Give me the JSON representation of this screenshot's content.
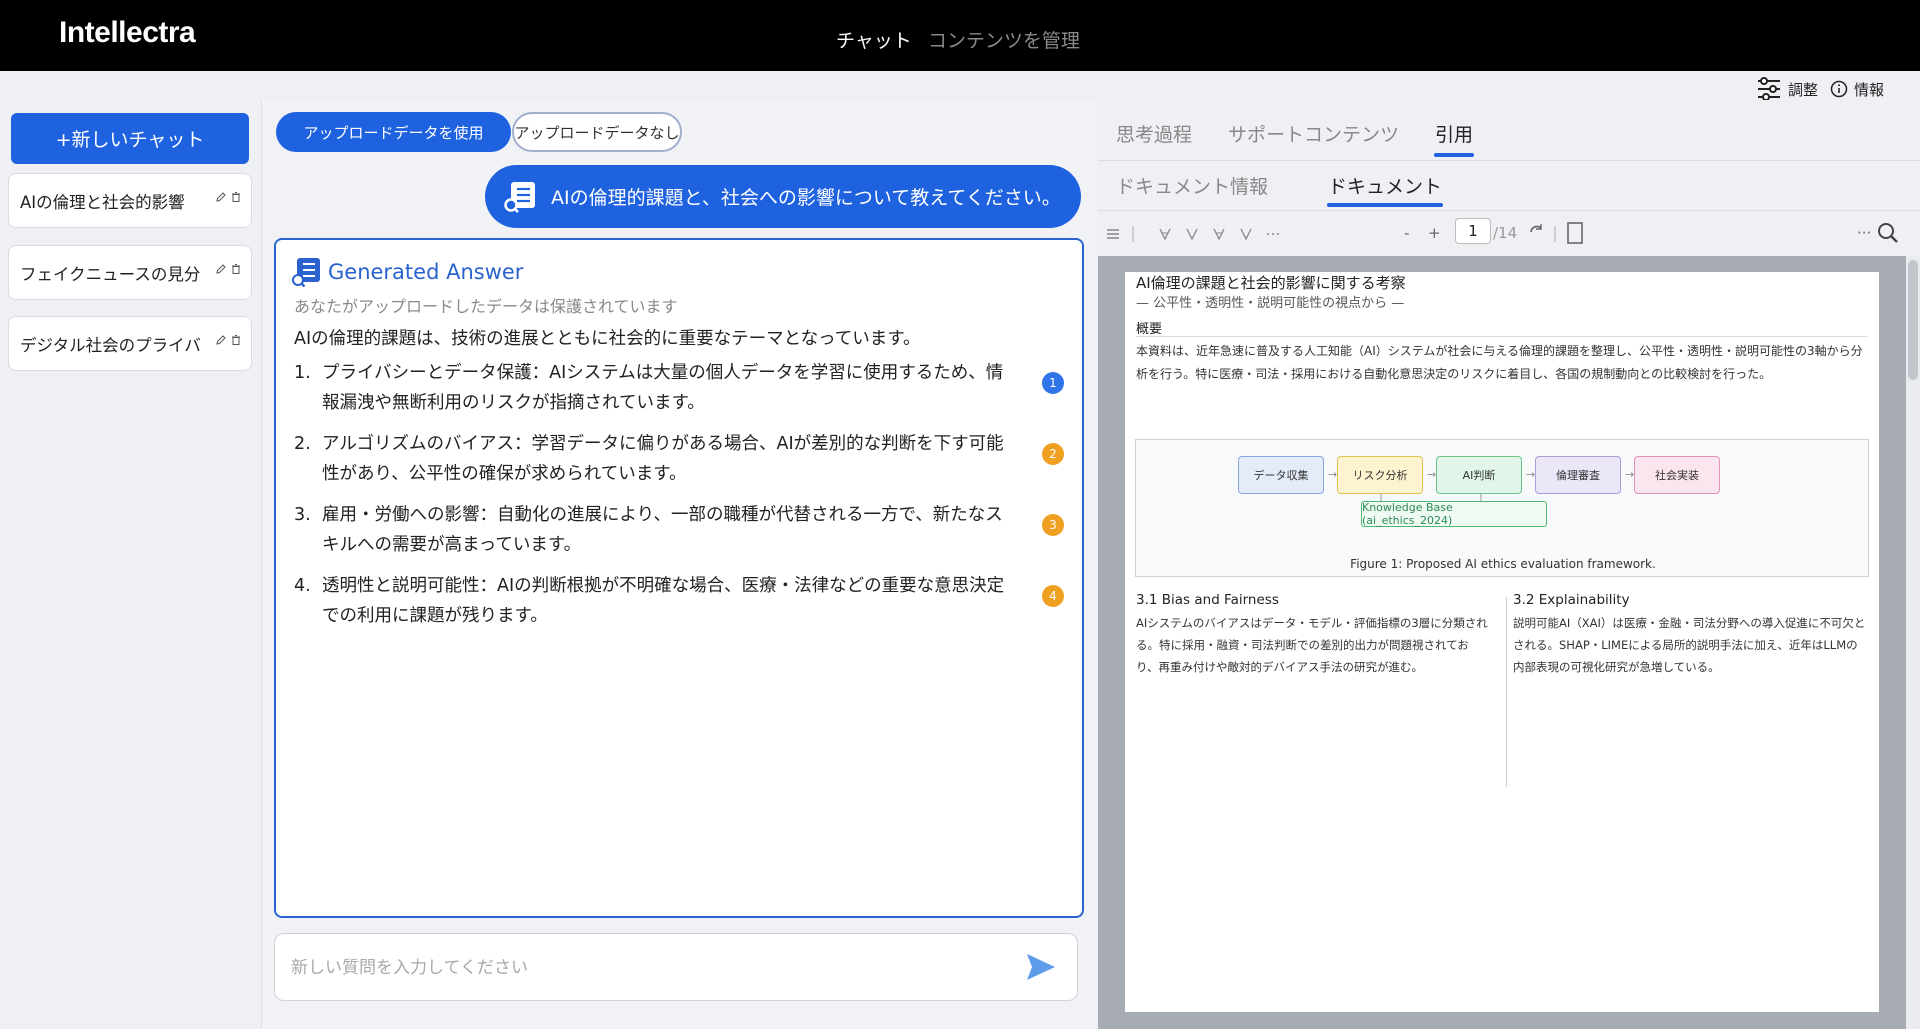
{
  "app": {
    "title": "Intellectra",
    "nav": [
      "チャット",
      "コンテンツを管理"
    ]
  },
  "utility": {
    "adjust_label": "調整",
    "info_label": "情報",
    "adjust_icon": "sliders-icon",
    "info_icon": "info-icon"
  },
  "sidebar": {
    "new_chat_label": "+新しいチャット",
    "chats": [
      {
        "label": "AIの倫理と社会的影響"
      },
      {
        "label": "フェイクニュースの見分け方"
      },
      {
        "label": "デジタル社会のプライバシー"
      }
    ]
  },
  "chat": {
    "mode_buttons": [
      "アップロードデータを使用",
      "アップロードデータなし"
    ],
    "user_message": "AIの倫理的課題と、社会への影響について教えてください。",
    "answer": {
      "title": "Generated Answer",
      "privacy_note": "あなたがアップロードしたデータは保護されています",
      "intro": "AIの倫理的課題は、技術の進展とともに社会的に重要なテーマとなっています。",
      "items": [
        {
          "num": "1.",
          "text": "プライバシーとデータ保護：AIシステムは大量の個人データを学習に使用するため、情報漏洩や無断利用のリスクが指摘されています。",
          "cite": "1",
          "cite_color": "#2f74e8"
        },
        {
          "num": "2.",
          "text": "アルゴリズムのバイアス：学習データに偏りがある場合、AIが差別的な判断を下す可能性があり、公平性の確保が求められています。",
          "cite": "2",
          "cite_color": "#f0a020"
        },
        {
          "num": "3.",
          "text": "雇用・労働への影響：自動化の進展により、一部の職種が代替される一方で、新たなスキルへの需要が高まっています。",
          "cite": "3",
          "cite_color": "#f0a020"
        },
        {
          "num": "4.",
          "text": "透明性と説明可能性：AIの判断根拠が不明確な場合、医療・法律などの重要な意思決定での利用に課題が残ります。",
          "cite": "4",
          "cite_color": "#f0a020"
        }
      ]
    },
    "input_placeholder": "新しい質問を入力してください"
  },
  "right_panel": {
    "tabs": [
      "思考過程",
      "サポートコンテンツ",
      "引用"
    ],
    "subtabs": [
      "ドキュメント情報",
      "ドキュメント"
    ],
    "toolbar": {
      "zoom_out": "-",
      "zoom_in": "+",
      "page": "1",
      "total": "/14",
      "more": "···"
    },
    "document": {
      "title": "AI倫理の課題と社会的影響に関する考察",
      "subtitle": "— 公平性・透明性・説明可能性の視点から —",
      "heading": "概要",
      "abstract": "本資料は、近年急速に普及する人工知能（AI）システムが社会に与える倫理的課題を整理し、公平性・透明性・説明可能性の3軸から分析を行う。特に医療・司法・採用における自動化意思決定のリスクに着目し、各国の規制動向との比較検討を行った。",
      "figure": {
        "steps": [
          "データ収集",
          "リスク分析",
          "AI判断",
          "倫理審査",
          "社会実装"
        ],
        "kb_label": "Knowledge Base (ai_ethics_2024)",
        "caption": "Figure 1: Proposed AI ethics evaluation framework."
      },
      "sections": [
        {
          "heading": "3.1  Bias and Fairness",
          "body": "AIシステムのバイアスはデータ・モデル・評価指標の3層に分類される。特に採用・融資・司法判断での差別的出力が問題視されており、再重み付けや敵対的デバイアス手法の研究が進む。"
        },
        {
          "heading": "3.2  Explainability",
          "body": "説明可能AI（XAI）は医療・金融・司法分野への導入促進に不可欠とされる。SHAP・LIMEによる局所的説明手法に加え、近年はLLMの内部表現の可視化研究が急増している。"
        }
      ]
    }
  }
}
